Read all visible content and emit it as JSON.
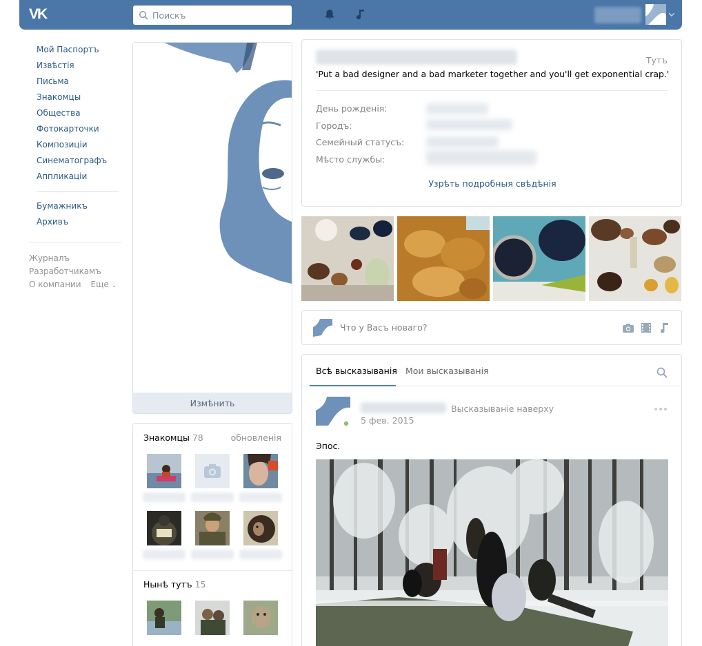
{
  "header": {
    "logo": "VK",
    "search_placeholder": "Поискъ",
    "icons": [
      "bell-icon",
      "music-icon"
    ]
  },
  "nav": {
    "items": [
      {
        "label": "Мой Паспортъ"
      },
      {
        "label": "Извѣстія"
      },
      {
        "label": "Письма"
      },
      {
        "label": "Знакомцы"
      },
      {
        "label": "Общества"
      },
      {
        "label": "Фотокарточки"
      },
      {
        "label": "Композиціи"
      },
      {
        "label": "Синематографъ"
      },
      {
        "label": "Аппликаціи"
      }
    ],
    "items2": [
      {
        "label": "Бумажникъ"
      },
      {
        "label": "Архивъ"
      }
    ],
    "footer": {
      "journal": "Журналъ",
      "developers": "Разработчикамъ",
      "about": "О компании",
      "more": "Еще"
    }
  },
  "profile": {
    "edit_label": "Измѣнить",
    "online": "Тутъ",
    "status": "'Put a bad designer and a bad marketer together and you'll get exponential crap.'",
    "fields": [
      {
        "label": "День рожденія:"
      },
      {
        "label": "Городъ:"
      },
      {
        "label": "Семейный статусъ:"
      },
      {
        "label": "Мѣсто службы:"
      }
    ],
    "show_more": "Узрѣть подробныя свѣдѣнія"
  },
  "friends": {
    "title": "Знакомцы",
    "count": "78",
    "updates": "обновленія"
  },
  "online_friends": {
    "title": "Нынѣ тутъ",
    "count": "15"
  },
  "composer": {
    "placeholder": "Что у Васъ новаго?",
    "icons": [
      "camera-icon",
      "film-icon",
      "music-icon"
    ]
  },
  "wall": {
    "tabs": [
      {
        "label": "Всѣ высказыванія",
        "active": true
      },
      {
        "label": "Мои высказыванія",
        "active": false
      }
    ],
    "post": {
      "pinned": "Высказываніе наверху",
      "date": "5 фев. 2015",
      "text": "Эпос."
    }
  },
  "colors": {
    "brand": "#4a76a8",
    "link": "#2a5885",
    "muted": "#939393",
    "online_dot": "#8ac176"
  }
}
